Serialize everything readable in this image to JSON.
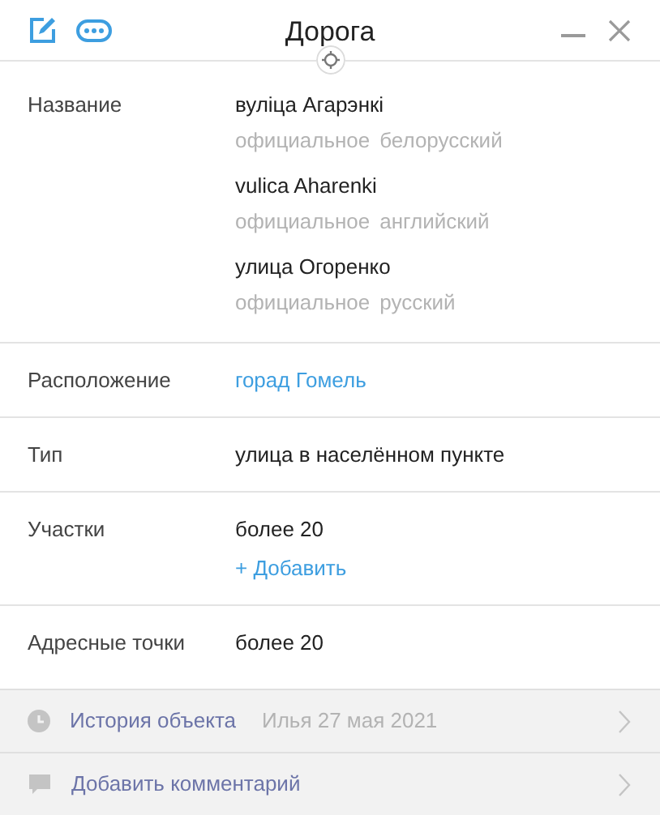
{
  "title": "Дорога",
  "fields": [
    {
      "label": "Название",
      "kind": "names",
      "names": [
        {
          "value": "вуліца Агарэнкі",
          "tags": [
            "официальное",
            "белорусский"
          ]
        },
        {
          "value": "vulica Aharenki",
          "tags": [
            "официальное",
            "английский"
          ]
        },
        {
          "value": "улица Огоренко",
          "tags": [
            "официальное",
            "русский"
          ]
        }
      ]
    },
    {
      "label": "Расположение",
      "kind": "link",
      "value": "горад Гомель"
    },
    {
      "label": "Тип",
      "kind": "text",
      "value": "улица в населённом пункте"
    },
    {
      "label": "Участки",
      "kind": "text",
      "value": "более 20",
      "action": "+ Добавить"
    },
    {
      "label": "Адресные точки",
      "kind": "text",
      "value": "более 20"
    }
  ],
  "footer": [
    {
      "kind": "history",
      "label": "История объекта",
      "meta": "Илья 27 мая 2021"
    },
    {
      "kind": "comment",
      "label": "Добавить комментарий"
    }
  ]
}
